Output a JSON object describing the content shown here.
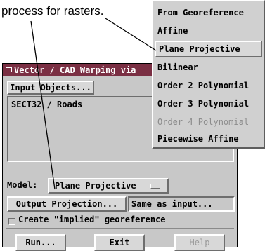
{
  "caption": "process for rasters.",
  "dialog": {
    "title": "Vector / CAD Warping via",
    "input_objects_label": "Input Objects...",
    "input_list": [
      "SECT32 / Roads"
    ],
    "model_label": "Model:",
    "model_value": "Plane Projective",
    "output_projection_label": "Output Projection...",
    "output_projection_value": "Same as input...",
    "create_georeference_label": "Create \"implied\" georeference",
    "create_georeference_checked": false,
    "run_label": "Run...",
    "exit_label": "Exit",
    "help_label": "Help"
  },
  "model_menu": {
    "items": [
      {
        "label": "From Georeference",
        "state": "normal"
      },
      {
        "label": "Affine",
        "state": "normal"
      },
      {
        "label": "Plane Projective",
        "state": "selected"
      },
      {
        "label": "Bilinear",
        "state": "normal"
      },
      {
        "label": "Order 2 Polynomial",
        "state": "normal"
      },
      {
        "label": "Order 3 Polynomial",
        "state": "normal"
      },
      {
        "label": "Order 4 Polynomial",
        "state": "disabled"
      },
      {
        "label": "Piecewise Affine",
        "state": "normal"
      }
    ]
  },
  "colors": {
    "titlebar": "#7a2f43",
    "dialog_bg": "#c8c8c8",
    "disabled_text": "#8c8c8c"
  }
}
